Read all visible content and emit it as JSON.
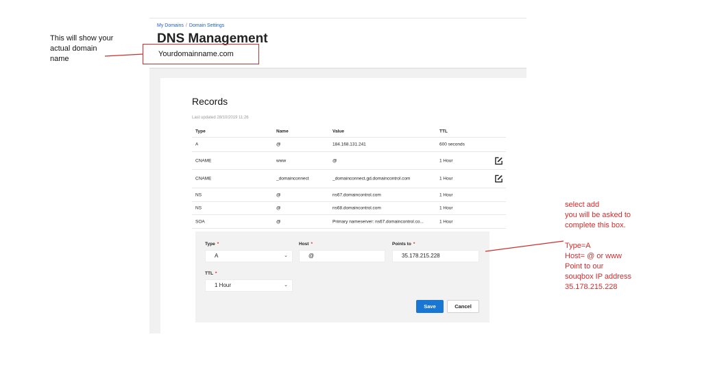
{
  "breadcrumb": {
    "items": [
      "My Domains",
      "Domain Settings"
    ],
    "separator": "/"
  },
  "page_title": "DNS Management",
  "domain_name": "Yourdomainname.com",
  "records": {
    "title": "Records",
    "last_updated": "Last updated 28/10/2019 11:26",
    "columns": [
      "Type",
      "Name",
      "Value",
      "TTL"
    ],
    "rows": [
      {
        "type": "A",
        "name": "@",
        "value": "184.168.131.241",
        "ttl": "600 seconds",
        "editable": false
      },
      {
        "type": "CNAME",
        "name": "www",
        "value": "@",
        "ttl": "1 Hour",
        "editable": true
      },
      {
        "type": "CNAME",
        "name": "_domainconnect",
        "value": "_domainconnect.gd.domaincontrol.com",
        "ttl": "1 Hour",
        "editable": true
      },
      {
        "type": "NS",
        "name": "@",
        "value": "ns67.domaincontrol.com",
        "ttl": "1 Hour",
        "editable": false
      },
      {
        "type": "NS",
        "name": "@",
        "value": "ns68.domaincontrol.com",
        "ttl": "1 Hour",
        "editable": false
      },
      {
        "type": "SOA",
        "name": "@",
        "value": "Primary nameserver: ns67.domaincontrol.co...",
        "ttl": "1 Hour",
        "editable": false
      }
    ]
  },
  "form": {
    "type_label": "Type",
    "type_value": "A",
    "host_label": "Host",
    "host_value": "@",
    "points_to_label": "Points to",
    "points_to_value": "35.178.215.228",
    "ttl_label": "TTL",
    "ttl_value": "1 Hour",
    "required_mark": "*",
    "save_label": "Save",
    "cancel_label": "Cancel"
  },
  "annotations": {
    "left_note": [
      "This will show  your",
      "actual domain",
      "name"
    ],
    "right_note_top": [
      "select add",
      "you will be asked to",
      "complete this box."
    ],
    "right_note_bottom": [
      "Type=A",
      "Host= @ or www",
      "Point to our",
      "souqbox IP address",
      "35.178.215.228"
    ]
  },
  "colors": {
    "annotation_red": "#d22b2b",
    "link_blue": "#1a5ec4",
    "primary_button": "#1976d2"
  },
  "icons": {
    "edit": "edit-icon",
    "select_arrow": "chevron-down-icon"
  }
}
